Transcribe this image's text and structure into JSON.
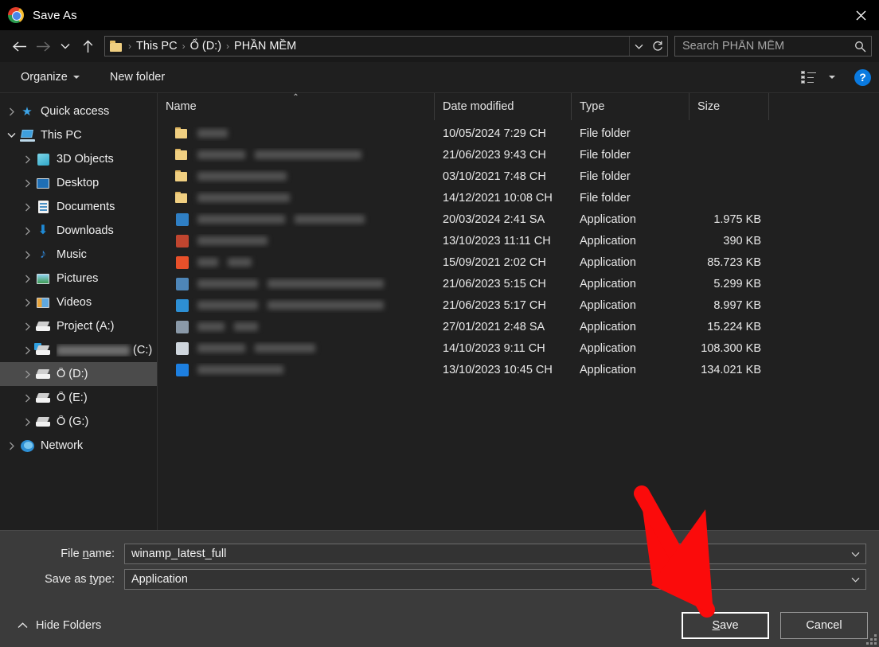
{
  "window": {
    "title": "Save As",
    "app_icon": "chrome-icon",
    "close_label": "✕"
  },
  "nav": {
    "back": "back-arrow",
    "forward": "forward-arrow",
    "recent": "chevron-down",
    "up": "up-arrow",
    "refresh_label": "↻",
    "breadcrumb": [
      "This PC",
      "Ổ (D:)",
      "PHẦN MỀM"
    ],
    "breadcrumb_separator": "›",
    "search_placeholder": "Search PHẦN MỀM",
    "search_value": ""
  },
  "toolbar": {
    "organize_label": "Organize",
    "new_folder_label": "New folder",
    "help_label": "?"
  },
  "sidebar": {
    "items": [
      {
        "label": "Quick access",
        "icon": "star-icon",
        "level": 0,
        "expander": "collapsed",
        "selected": false,
        "redacted": false
      },
      {
        "label": "This PC",
        "icon": "pc-icon",
        "level": 0,
        "expander": "expanded",
        "selected": false,
        "redacted": false
      },
      {
        "label": "3D Objects",
        "icon": "cube-icon",
        "level": 1,
        "expander": "collapsed",
        "selected": false,
        "redacted": false
      },
      {
        "label": "Desktop",
        "icon": "desktop-icon",
        "level": 1,
        "expander": "collapsed",
        "selected": false,
        "redacted": false
      },
      {
        "label": "Documents",
        "icon": "document-icon",
        "level": 1,
        "expander": "collapsed",
        "selected": false,
        "redacted": false
      },
      {
        "label": "Downloads",
        "icon": "download-icon",
        "level": 1,
        "expander": "collapsed",
        "selected": false,
        "redacted": false
      },
      {
        "label": "Music",
        "icon": "music-icon",
        "level": 1,
        "expander": "collapsed",
        "selected": false,
        "redacted": false
      },
      {
        "label": "Pictures",
        "icon": "picture-icon",
        "level": 1,
        "expander": "collapsed",
        "selected": false,
        "redacted": false
      },
      {
        "label": "Videos",
        "icon": "video-icon",
        "level": 1,
        "expander": "collapsed",
        "selected": false,
        "redacted": false
      },
      {
        "label": "Project (A:)",
        "icon": "drive-icon",
        "level": 1,
        "expander": "collapsed",
        "selected": false,
        "redacted": false
      },
      {
        "label": "(C:)",
        "icon": "windows-drive-icon",
        "level": 1,
        "expander": "collapsed",
        "selected": false,
        "redacted": true
      },
      {
        "label": "Ổ (D:)",
        "icon": "drive-icon",
        "level": 1,
        "expander": "collapsed",
        "selected": true,
        "redacted": false
      },
      {
        "label": "Ổ (E:)",
        "icon": "drive-icon",
        "level": 1,
        "expander": "collapsed",
        "selected": false,
        "redacted": false
      },
      {
        "label": "Ổ (G:)",
        "icon": "drive-icon",
        "level": 1,
        "expander": "collapsed",
        "selected": false,
        "redacted": false
      },
      {
        "label": "Network",
        "icon": "network-icon",
        "level": 0,
        "expander": "collapsed",
        "selected": false,
        "redacted": false
      }
    ]
  },
  "filelist": {
    "columns": [
      "Name",
      "Date modified",
      "Type",
      "Size"
    ],
    "sort_column": "Name",
    "sort_direction": "ascending",
    "rows": [
      {
        "name": "",
        "redacted_widths": [
          38
        ],
        "date": "10/05/2024 7:29 CH",
        "type": "File folder",
        "size": "",
        "icon": "folder-icon",
        "icon_color": ""
      },
      {
        "name": "",
        "redacted_widths": [
          60,
          134
        ],
        "date": "21/06/2023 9:43 CH",
        "type": "File folder",
        "size": "",
        "icon": "folder-icon",
        "icon_color": ""
      },
      {
        "name": "",
        "redacted_widths": [
          112
        ],
        "date": "03/10/2021 7:48 CH",
        "type": "File folder",
        "size": "",
        "icon": "folder-icon",
        "icon_color": ""
      },
      {
        "name": "",
        "redacted_widths": [
          116
        ],
        "date": "14/12/2021 10:08 CH",
        "type": "File folder",
        "size": "",
        "icon": "folder-icon",
        "icon_color": ""
      },
      {
        "name": "",
        "redacted_widths": [
          110,
          88
        ],
        "date": "20/03/2024 2:41 SA",
        "type": "Application",
        "size": "1.975 KB",
        "icon": "app-icon",
        "icon_color": "#2f7fc4"
      },
      {
        "name": "",
        "redacted_widths": [
          88
        ],
        "date": "13/10/2023 11:11 CH",
        "type": "Application",
        "size": "390 KB",
        "icon": "app-icon",
        "icon_color": "#c0452f"
      },
      {
        "name": "",
        "redacted_widths": [
          26,
          30
        ],
        "date": "15/09/2021 2:02 CH",
        "type": "Application",
        "size": "85.723 KB",
        "icon": "app-icon",
        "icon_color": "#e8502a"
      },
      {
        "name": "",
        "redacted_widths": [
          76,
          146
        ],
        "date": "21/06/2023 5:15 CH",
        "type": "Application",
        "size": "5.299 KB",
        "icon": "app-icon",
        "icon_color": "#4e86b8"
      },
      {
        "name": "",
        "redacted_widths": [
          76,
          146
        ],
        "date": "21/06/2023 5:17 CH",
        "type": "Application",
        "size": "8.997 KB",
        "icon": "app-icon",
        "icon_color": "#2d8fd4"
      },
      {
        "name": "",
        "redacted_widths": [
          34,
          30
        ],
        "date": "27/01/2021 2:48 SA",
        "type": "Application",
        "size": "15.224 KB",
        "icon": "app-icon",
        "icon_color": "#8a99a8"
      },
      {
        "name": "",
        "redacted_widths": [
          60,
          76
        ],
        "date": "14/10/2023 9:11 CH",
        "type": "Application",
        "size": "108.300 KB",
        "icon": "app-icon",
        "icon_color": "#cfd6dd"
      },
      {
        "name": "",
        "redacted_widths": [
          108
        ],
        "date": "13/10/2023 10:45 CH",
        "type": "Application",
        "size": "134.021 KB",
        "icon": "app-icon",
        "icon_color": "#1d7fe0"
      }
    ]
  },
  "form": {
    "filename_label_pre": "File ",
    "filename_label_accel": "n",
    "filename_label_post": "ame:",
    "filename_value": "winamp_latest_full",
    "savetype_label_pre": "Save as ",
    "savetype_label_accel": "t",
    "savetype_label_post": "ype:",
    "savetype_value": "Application"
  },
  "footer": {
    "hide_folders_label": "Hide Folders",
    "save_label_pre": "",
    "save_label_accel": "S",
    "save_label_post": "ave",
    "cancel_label": "Cancel"
  },
  "annotation": {
    "arrow_color": "#fb0b0b",
    "points_at": "save-button"
  },
  "colors": {
    "titlebar_bg": "#000000",
    "navbar_bg": "#191919",
    "dialog_bg": "#1f1f1f",
    "filelist_bg": "#202020",
    "form_bg": "#3b3b3b",
    "selection_bg": "#4b4b4b",
    "accent_blue": "#0a7ae0",
    "text_primary": "#f0f0f0"
  }
}
